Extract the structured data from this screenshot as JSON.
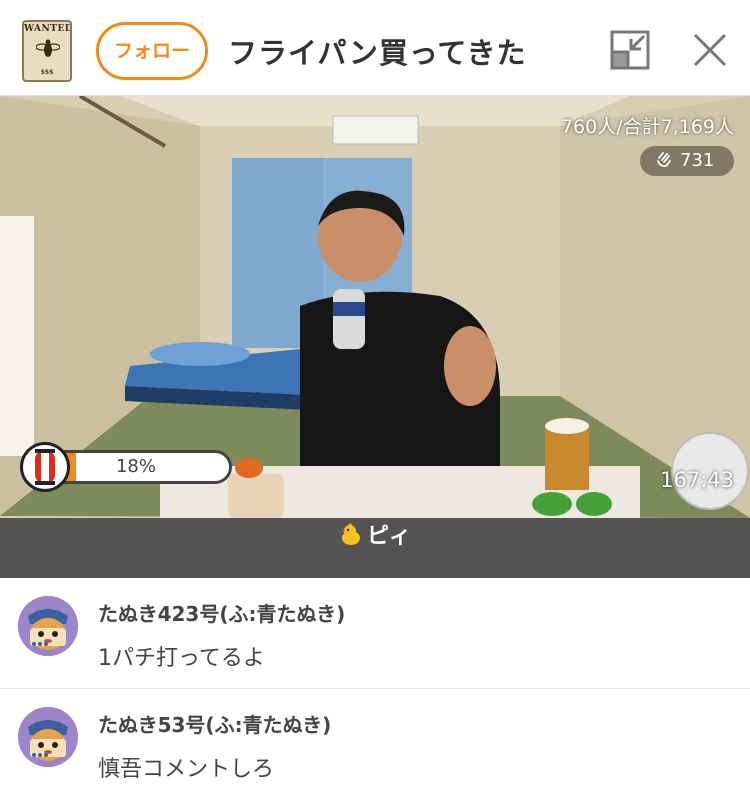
{
  "header": {
    "avatar_text": "WANTED",
    "follow_label": "フォロー",
    "title": "フライパン買ってきた"
  },
  "video": {
    "viewer_count": "760人/合計7,169人",
    "clap_count": "731",
    "progress_label": "18%",
    "progress_fraction": 0.18,
    "timer": "167:43"
  },
  "banner": {
    "label": "ピィ"
  },
  "comments": [
    {
      "name": "たぬき423号(ふ:青たぬき)",
      "text": "1パチ打ってるよ"
    },
    {
      "name": "たぬき53号(ふ:青たぬき)",
      "text": "慎吾コメントしろ"
    }
  ],
  "colors": {
    "accent": "#f08c1e",
    "banner": "#555351"
  },
  "icons": [
    "wanted-poster-avatar",
    "minimize-icon",
    "close-icon",
    "clap-icon",
    "lantern-icon",
    "chick-icon",
    "tanuki-avatar"
  ]
}
